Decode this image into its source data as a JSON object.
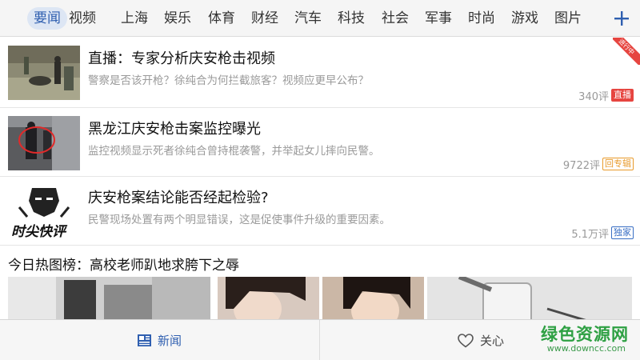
{
  "nav": {
    "tabs": [
      "要闻",
      "视频",
      "上海",
      "娱乐",
      "体育",
      "财经",
      "汽车",
      "科技",
      "社会",
      "军事",
      "时尚",
      "游戏",
      "图片"
    ],
    "active_index": 0,
    "add_icon": "plus-icon",
    "accent": "#2f5fb0"
  },
  "feed": {
    "items": [
      {
        "headline": "直播：专家分析庆安枪击视频",
        "summary": "警察是否该开枪？徐纯合为何拦截旅客？视频应更早公布？",
        "comments": "340评",
        "badge": "直播",
        "badge_type": "live",
        "corner_flag": "进行中"
      },
      {
        "headline": "黑龙江庆安枪击案监控曝光",
        "summary": "监控视频显示死者徐纯合曾持棍袭警，并举起女儿摔向民警。",
        "comments": "9722评",
        "badge": "专辑",
        "badge_type": "topic"
      },
      {
        "headline": "庆安枪案结论能否经起检验?",
        "summary": "民警现场处置有两个明显错误，这是促使事件升级的重要因素。",
        "comments": "5.1万评",
        "badge": "独家",
        "badge_type": "excl",
        "thumb_text": "时尖快评"
      }
    ],
    "gallery_title": "今日热图榜：高校老师趴地求胯下之辱"
  },
  "bottombar": {
    "news_label": "新闻",
    "care_label": "关心",
    "news_icon": "news-icon",
    "care_icon": "heart-icon"
  },
  "watermark": {
    "name": "绿色资源网",
    "url": "www.downcc.com"
  }
}
